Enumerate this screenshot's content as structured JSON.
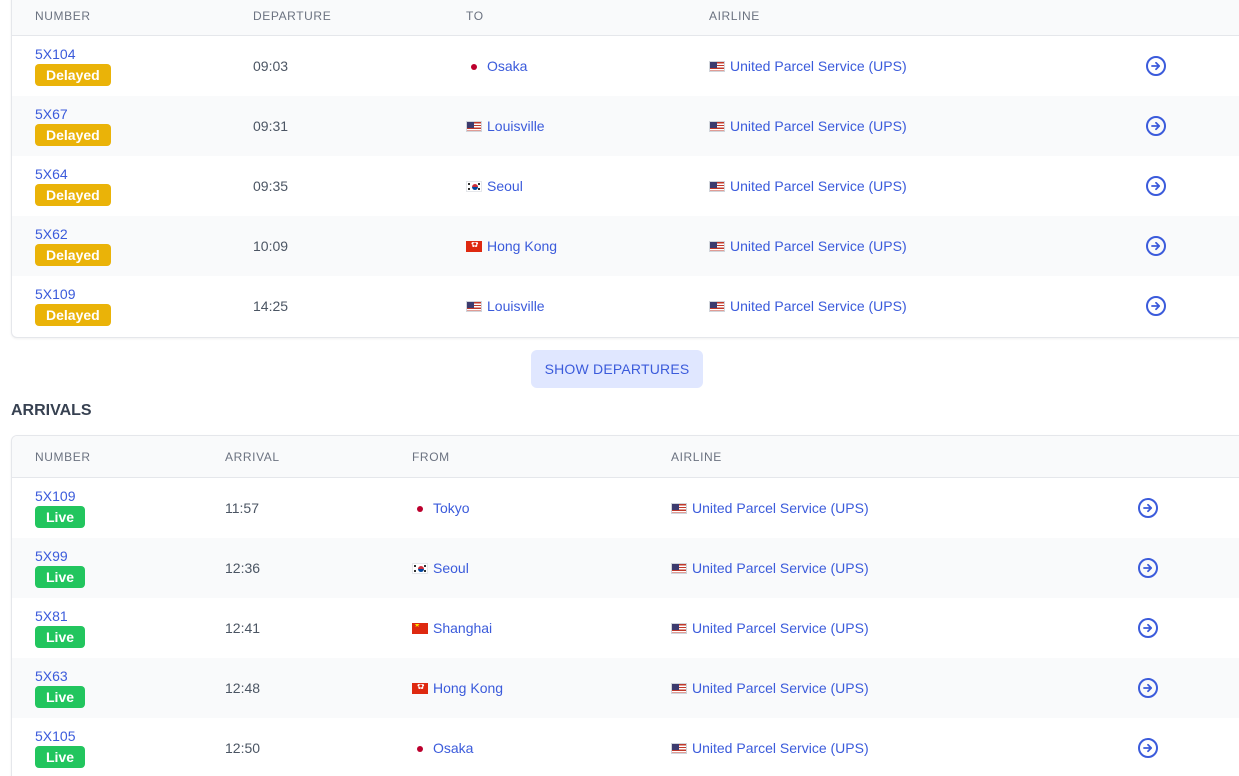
{
  "departures": {
    "headers": {
      "number": "NUMBER",
      "time": "DEPARTURE",
      "place": "TO",
      "airline": "AIRLINE"
    },
    "rows": [
      {
        "number": "5X104",
        "status": "Delayed",
        "time": "09:03",
        "place": "Osaka",
        "flag": "jp",
        "airline": "United Parcel Service (UPS)"
      },
      {
        "number": "5X67",
        "status": "Delayed",
        "time": "09:31",
        "place": "Louisville",
        "flag": "us",
        "airline": "United Parcel Service (UPS)"
      },
      {
        "number": "5X64",
        "status": "Delayed",
        "time": "09:35",
        "place": "Seoul",
        "flag": "kr",
        "airline": "United Parcel Service (UPS)"
      },
      {
        "number": "5X62",
        "status": "Delayed",
        "time": "10:09",
        "place": "Hong Kong",
        "flag": "hk",
        "airline": "United Parcel Service (UPS)"
      },
      {
        "number": "5X109",
        "status": "Delayed",
        "time": "14:25",
        "place": "Louisville",
        "flag": "us",
        "airline": "United Parcel Service (UPS)"
      }
    ],
    "show_button": "SHOW DEPARTURES"
  },
  "arrivals": {
    "title": "ARRIVALS",
    "headers": {
      "number": "NUMBER",
      "time": "ARRIVAL",
      "place": "FROM",
      "airline": "AIRLINE"
    },
    "rows": [
      {
        "number": "5X109",
        "status": "Live",
        "time": "11:57",
        "place": "Tokyo",
        "flag": "jp",
        "airline": "United Parcel Service (UPS)"
      },
      {
        "number": "5X99",
        "status": "Live",
        "time": "12:36",
        "place": "Seoul",
        "flag": "kr",
        "airline": "United Parcel Service (UPS)"
      },
      {
        "number": "5X81",
        "status": "Live",
        "time": "12:41",
        "place": "Shanghai",
        "flag": "cn",
        "airline": "United Parcel Service (UPS)"
      },
      {
        "number": "5X63",
        "status": "Live",
        "time": "12:48",
        "place": "Hong Kong",
        "flag": "hk",
        "airline": "United Parcel Service (UPS)"
      },
      {
        "number": "5X105",
        "status": "Live",
        "time": "12:50",
        "place": "Osaka",
        "flag": "jp",
        "airline": "United Parcel Service (UPS)"
      }
    ]
  },
  "icons": {
    "row_action": "arrow-right-circle-icon"
  },
  "colors": {
    "link": "#3b5bdb",
    "delayed": "#eab308",
    "live": "#22c55e",
    "button_bg": "#e0e7ff"
  }
}
